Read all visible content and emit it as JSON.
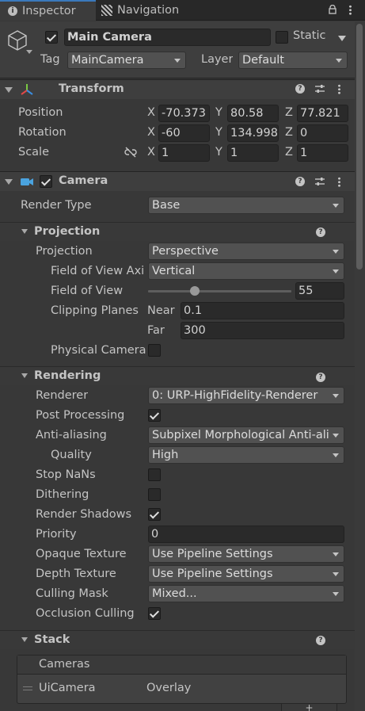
{
  "tabs": [
    {
      "label": "Inspector",
      "icon": "info-icon"
    },
    {
      "label": "Navigation",
      "icon": "navigation-icon"
    }
  ],
  "gameobject": {
    "name": "Main Camera",
    "static_label": "Static",
    "tag_label": "Tag",
    "tag_value": "MainCamera",
    "layer_label": "Layer",
    "layer_value": "Default"
  },
  "transform": {
    "title": "Transform",
    "position_label": "Position",
    "rotation_label": "Rotation",
    "scale_label": "Scale",
    "position": {
      "x": "-70.373",
      "y": "80.58",
      "z": "77.821"
    },
    "rotation": {
      "x": "-60",
      "y": "134.998",
      "z": "0"
    },
    "scale": {
      "x": "1",
      "y": "1",
      "z": "1"
    },
    "axis_x": "X",
    "axis_y": "Y",
    "axis_z": "Z"
  },
  "camera": {
    "title": "Camera",
    "render_type_label": "Render Type",
    "render_type_value": "Base"
  },
  "projection": {
    "section_title": "Projection",
    "projection_label": "Projection",
    "projection_value": "Perspective",
    "fov_axis_label": "Field of View Axi",
    "fov_axis_value": "Vertical",
    "fov_label": "Field of View",
    "fov_value": "55",
    "fov_slider_fraction": 0.18,
    "clipping_label": "Clipping Planes",
    "near_label": "Near",
    "near_value": "0.1",
    "far_label": "Far",
    "far_value": "300",
    "physical_label": "Physical Camera"
  },
  "rendering": {
    "section_title": "Rendering",
    "renderer_label": "Renderer",
    "renderer_value": "0: URP-HighFidelity-Renderer",
    "post_label": "Post Processing",
    "aa_label": "Anti-aliasing",
    "aa_value": "Subpixel Morphological Anti-ali",
    "quality_label": "Quality",
    "quality_value": "High",
    "stopnans_label": "Stop NaNs",
    "dithering_label": "Dithering",
    "shadows_label": "Render Shadows",
    "priority_label": "Priority",
    "priority_value": "0",
    "opaque_label": "Opaque Texture",
    "opaque_value": "Use Pipeline Settings",
    "depth_label": "Depth Texture",
    "depth_value": "Use Pipeline Settings",
    "culling_label": "Culling Mask",
    "culling_value": "Mixed...",
    "occlusion_label": "Occlusion Culling"
  },
  "stack": {
    "section_title": "Stack",
    "list_header": "Cameras",
    "items": [
      {
        "name": "UiCamera",
        "type": "Overlay"
      }
    ],
    "add_label": "+"
  },
  "colors": {
    "accent": "#3a79bb",
    "camera_icon": "#4aa3df"
  }
}
